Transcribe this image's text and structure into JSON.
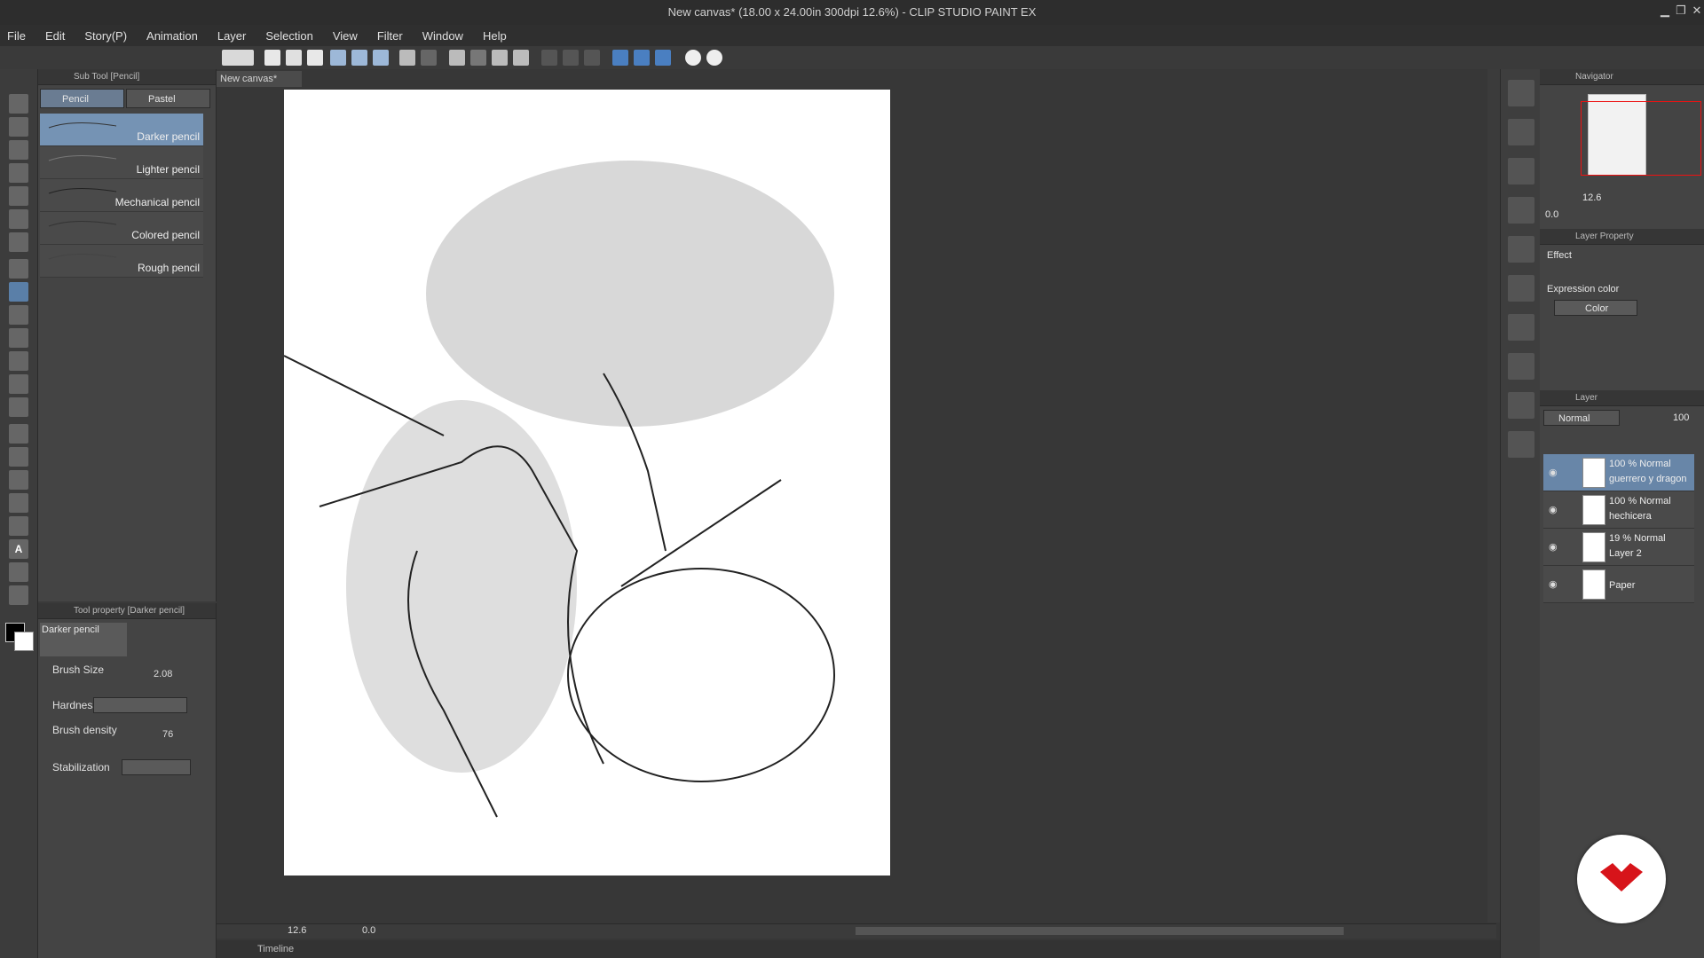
{
  "window": {
    "title": "New canvas* (18.00 x 24.00in 300dpi 12.6%) - CLIP STUDIO PAINT EX"
  },
  "menu": [
    "File",
    "Edit",
    "Story(P)",
    "Animation",
    "Layer",
    "Selection",
    "View",
    "Filter",
    "Window",
    "Help"
  ],
  "subtool": {
    "panel_title": "Sub Tool [Pencil]",
    "tabs": [
      "Pencil",
      "Pastel"
    ],
    "brushes": [
      "Darker pencil",
      "Lighter pencil",
      "Mechanical pencil",
      "Colored pencil",
      "Rough pencil"
    ]
  },
  "toolprop": {
    "panel_title": "Tool property [Darker pencil]",
    "brush_name": "Darker pencil",
    "brush_size_label": "Brush Size",
    "brush_size_value": "2.08",
    "hardness_label": "Hardness",
    "density_label": "Brush density",
    "density_value": "76",
    "stabilization_label": "Stabilization"
  },
  "canvas": {
    "tab": "New canvas*",
    "zoom": "12.6",
    "rotation": "0.0",
    "timeline_label": "Timeline"
  },
  "navigator": {
    "title": "Navigator",
    "zoom": "12.6",
    "rotation": "0.0"
  },
  "layer_property": {
    "title": "Layer Property",
    "effect_label": "Effect",
    "expression_label": "Expression color",
    "expression_value": "Color"
  },
  "layers": {
    "title": "Layer",
    "blend_mode": "Normal",
    "opacity": "100",
    "items": [
      {
        "line1": "100 % Normal",
        "line2": "guerrero y dragon"
      },
      {
        "line1": "100 % Normal",
        "line2": "hechicera"
      },
      {
        "line1": "19 % Normal",
        "line2": "Layer 2"
      },
      {
        "line1": "",
        "line2": "Paper"
      }
    ]
  },
  "colors": {
    "selection": "#6886a8",
    "logo_red": "#d7141a"
  }
}
